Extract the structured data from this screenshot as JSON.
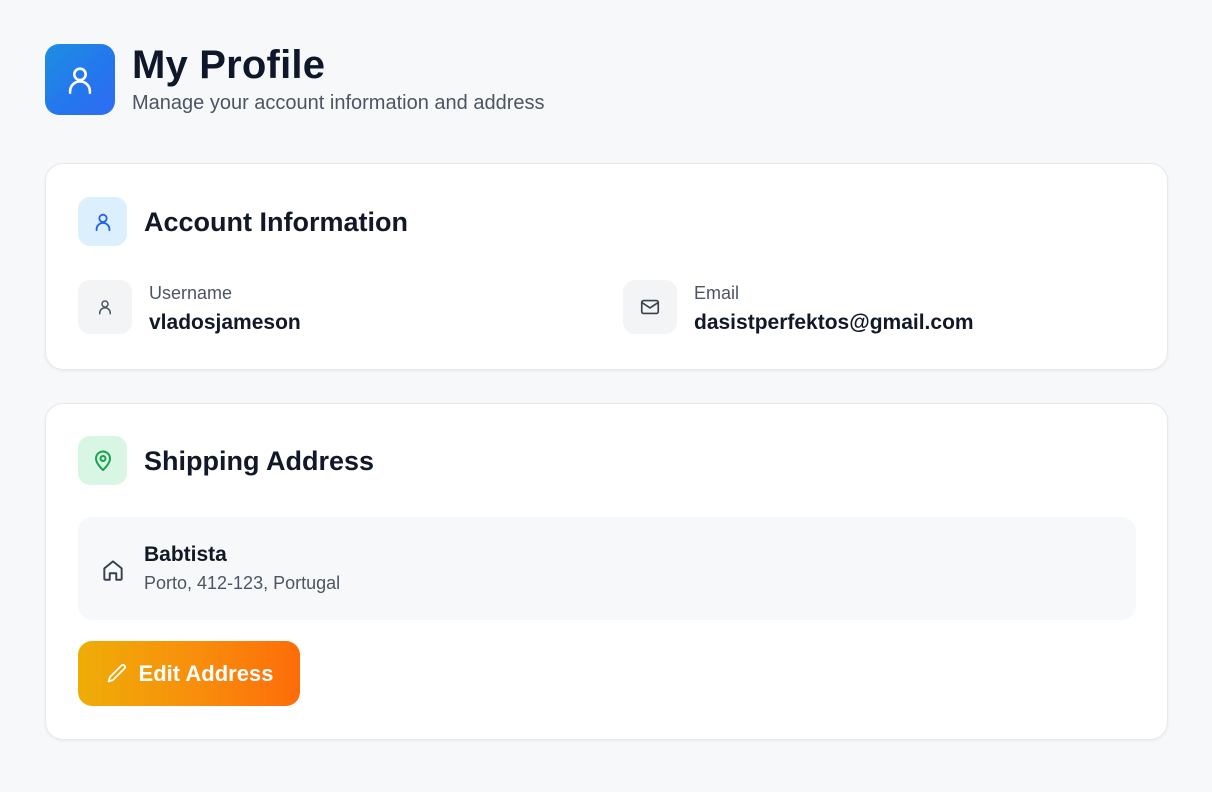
{
  "header": {
    "title": "My Profile",
    "subtitle": "Manage your account information and address",
    "icon": "user-icon",
    "accent": "#2575ee"
  },
  "account": {
    "title": "Account Information",
    "icon": "user-icon",
    "fields": [
      {
        "label": "Username",
        "value": "vladosjameson",
        "icon": "user-icon"
      },
      {
        "label": "Email",
        "value": "dasistperfektos@gmail.com",
        "icon": "mail-icon"
      }
    ]
  },
  "shipping": {
    "title": "Shipping Address",
    "icon": "map-pin-icon",
    "address": {
      "name": "Babtista",
      "line": "Porto, 412-123, Portugal",
      "icon": "home-icon"
    },
    "edit_label": "Edit Address",
    "edit_icon": "pencil-icon"
  },
  "colors": {
    "background": "#f7f8fa",
    "button_gradient_start": "#efad07",
    "button_gradient_end": "#fd6c0a",
    "green_accent": "#16a34a"
  }
}
